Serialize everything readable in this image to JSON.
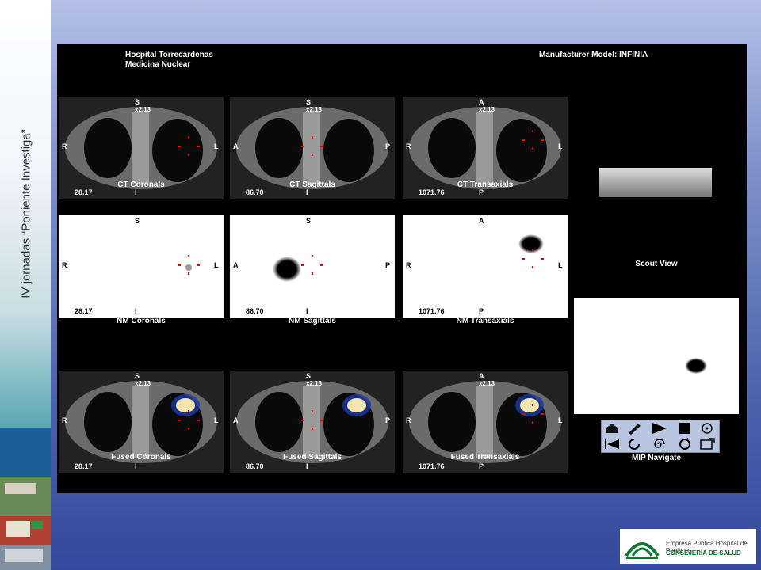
{
  "sidebar": {
    "title": "IV jornadas “Poniente Investiga”"
  },
  "header": {
    "hospital": "Hospital Torrecárdenas",
    "department": "Medicina Nuclear",
    "manufacturer": "Manufacturer Model: INFINIA"
  },
  "panels": [
    {
      "caption": "CT Coronals",
      "top": "S",
      "zoom": "x2.13",
      "left": "R",
      "right": "L",
      "bottom": "I",
      "coord": "28.17"
    },
    {
      "caption": "CT Sagittals",
      "top": "S",
      "zoom": "x2.13",
      "left": "A",
      "right": "P",
      "bottom": "I",
      "coord": "86.70"
    },
    {
      "caption": "CT Transaxials",
      "top": "A",
      "zoom": "x2.13",
      "left": "R",
      "right": "L",
      "bottom": "P",
      "coord": "1071.76"
    },
    {
      "caption": "NM Coronals",
      "top": "S",
      "zoom": "",
      "left": "R",
      "right": "L",
      "bottom": "I",
      "coord": "28.17"
    },
    {
      "caption": "NM Sagittals",
      "top": "S",
      "zoom": "",
      "left": "A",
      "right": "P",
      "bottom": "I",
      "coord": "86.70"
    },
    {
      "caption": "NM Transaxials",
      "top": "A",
      "zoom": "",
      "left": "R",
      "right": "L",
      "bottom": "P",
      "coord": "1071.76"
    },
    {
      "caption": "Fused Coronals",
      "top": "S",
      "zoom": "x2.13",
      "left": "R",
      "right": "L",
      "bottom": "I",
      "coord": "28.17"
    },
    {
      "caption": "Fused Sagittals",
      "top": "S",
      "zoom": "x2.13",
      "left": "A",
      "right": "P",
      "bottom": "I",
      "coord": "86.70"
    },
    {
      "caption": "Fused Transaxials",
      "top": "A",
      "zoom": "x2.13",
      "left": "R",
      "right": "L",
      "bottom": "P",
      "coord": "1071.76"
    }
  ],
  "scout": {
    "caption": "Scout View"
  },
  "mip": {
    "caption": "MIP Navigate"
  },
  "logo": {
    "line1": "Empresa Pública Hospital de Poniente",
    "line2": "CONSEJERÍA DE SALUD"
  }
}
